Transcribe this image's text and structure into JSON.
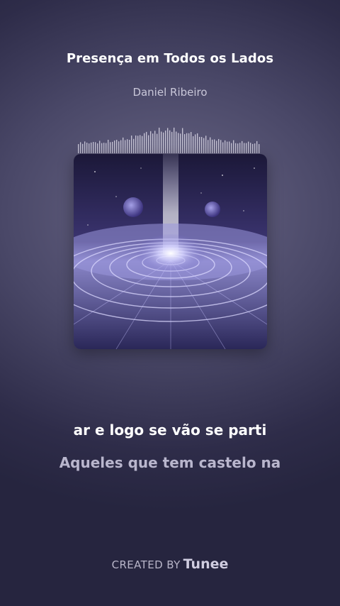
{
  "song": {
    "title": "Presença em Todos os Lados",
    "artist": "Daniel Ribeiro"
  },
  "lyrics": {
    "current": "ar e logo se vão se parti",
    "next": "Aqueles que tem castelo na"
  },
  "credit": {
    "prefix": "CREATED BY",
    "brand": "Tunee"
  },
  "cover_art": {
    "description_icon": "cosmic-mandala-artwork"
  },
  "colors": {
    "background": "#2e2c49",
    "text_primary": "#ffffff",
    "text_secondary": "#b9b6cd"
  }
}
